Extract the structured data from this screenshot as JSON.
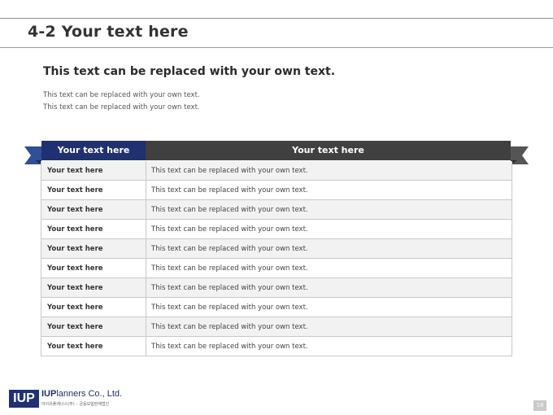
{
  "slide": {
    "title": "4-2 Your text here",
    "subtitle": "This text can be replaced with your own text.",
    "body_lines": [
      "This text can be replaced with your own text.",
      "This text can be replaced with your own text."
    ]
  },
  "table": {
    "headers": [
      "Your text here",
      "Your text here"
    ],
    "rows": [
      [
        "Your text here",
        "This text can be replaced with your own text."
      ],
      [
        "Your text here",
        "This text can be replaced with your own text."
      ],
      [
        "Your text here",
        "This text can be replaced with your own text."
      ],
      [
        "Your text here",
        "This text can be replaced with your own text."
      ],
      [
        "Your text here",
        "This text can be replaced with your own text."
      ],
      [
        "Your text here",
        "This text can be replaced with your own text."
      ],
      [
        "Your text here",
        "This text can be replaced with your own text."
      ],
      [
        "Your text here",
        "This text can be replaced with your own text."
      ],
      [
        "Your text here",
        "This text can be replaced with your own text."
      ],
      [
        "Your text here",
        "This text can be replaced with your own text."
      ]
    ]
  },
  "footer": {
    "logo_mark": "IUP",
    "logo_name_bold": "IUP",
    "logo_name_rest": "lanners Co., Ltd.",
    "logo_sub": "아이유플래너스(주) – 금융보험판매법인",
    "page_number": "18"
  },
  "colors": {
    "ribbon_left": "#1f3170",
    "ribbon_right": "#404040",
    "ribbon_fold": "#2a2a2a"
  }
}
